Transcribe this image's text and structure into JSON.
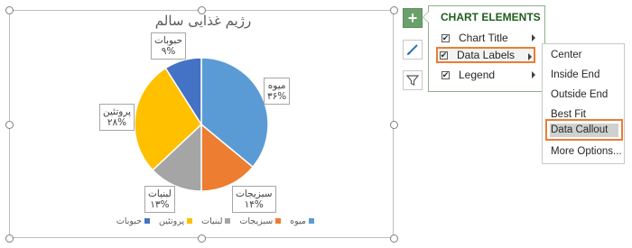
{
  "chart": {
    "title": "رژیم غذایی سالم",
    "slices": [
      {
        "name": "میوه",
        "value": 36,
        "label": "۳۶%",
        "color": "#5b9bd5"
      },
      {
        "name": "سبزیجات",
        "value": 14,
        "label": "۱۴%",
        "color": "#ed7d31"
      },
      {
        "name": "لبنیات",
        "value": 13,
        "label": "۱۳%",
        "color": "#a5a5a5"
      },
      {
        "name": "پروتئین",
        "value": 28,
        "label": "۲۸%",
        "color": "#ffc000"
      },
      {
        "name": "حبوبات",
        "value": 9,
        "label": "۹%",
        "color": "#4472c4"
      }
    ]
  },
  "chart_data": {
    "type": "pie",
    "title": "رژیم غذایی سالم",
    "categories": [
      "میوه",
      "سبزیجات",
      "لبنیات",
      "پروتئین",
      "حبوبات"
    ],
    "values": [
      36,
      14,
      13,
      28,
      9
    ],
    "legend": "bottom"
  },
  "side_buttons": {
    "plus": "+",
    "brush_icon": "brush-icon",
    "filter_icon": "filter-icon"
  },
  "chart_elements": {
    "title": "CHART ELEMENTS",
    "items": [
      {
        "label": "Chart Title",
        "checked": true
      },
      {
        "label": "Data Labels",
        "checked": true,
        "highlighted": true
      },
      {
        "label": "Legend",
        "checked": true
      }
    ],
    "checkmark": "✔"
  },
  "data_labels_menu": {
    "items": [
      "Center",
      "Inside End",
      "Outside End",
      "Best Fit",
      "Data Callout",
      "More Options..."
    ],
    "selected": "Data Callout"
  }
}
